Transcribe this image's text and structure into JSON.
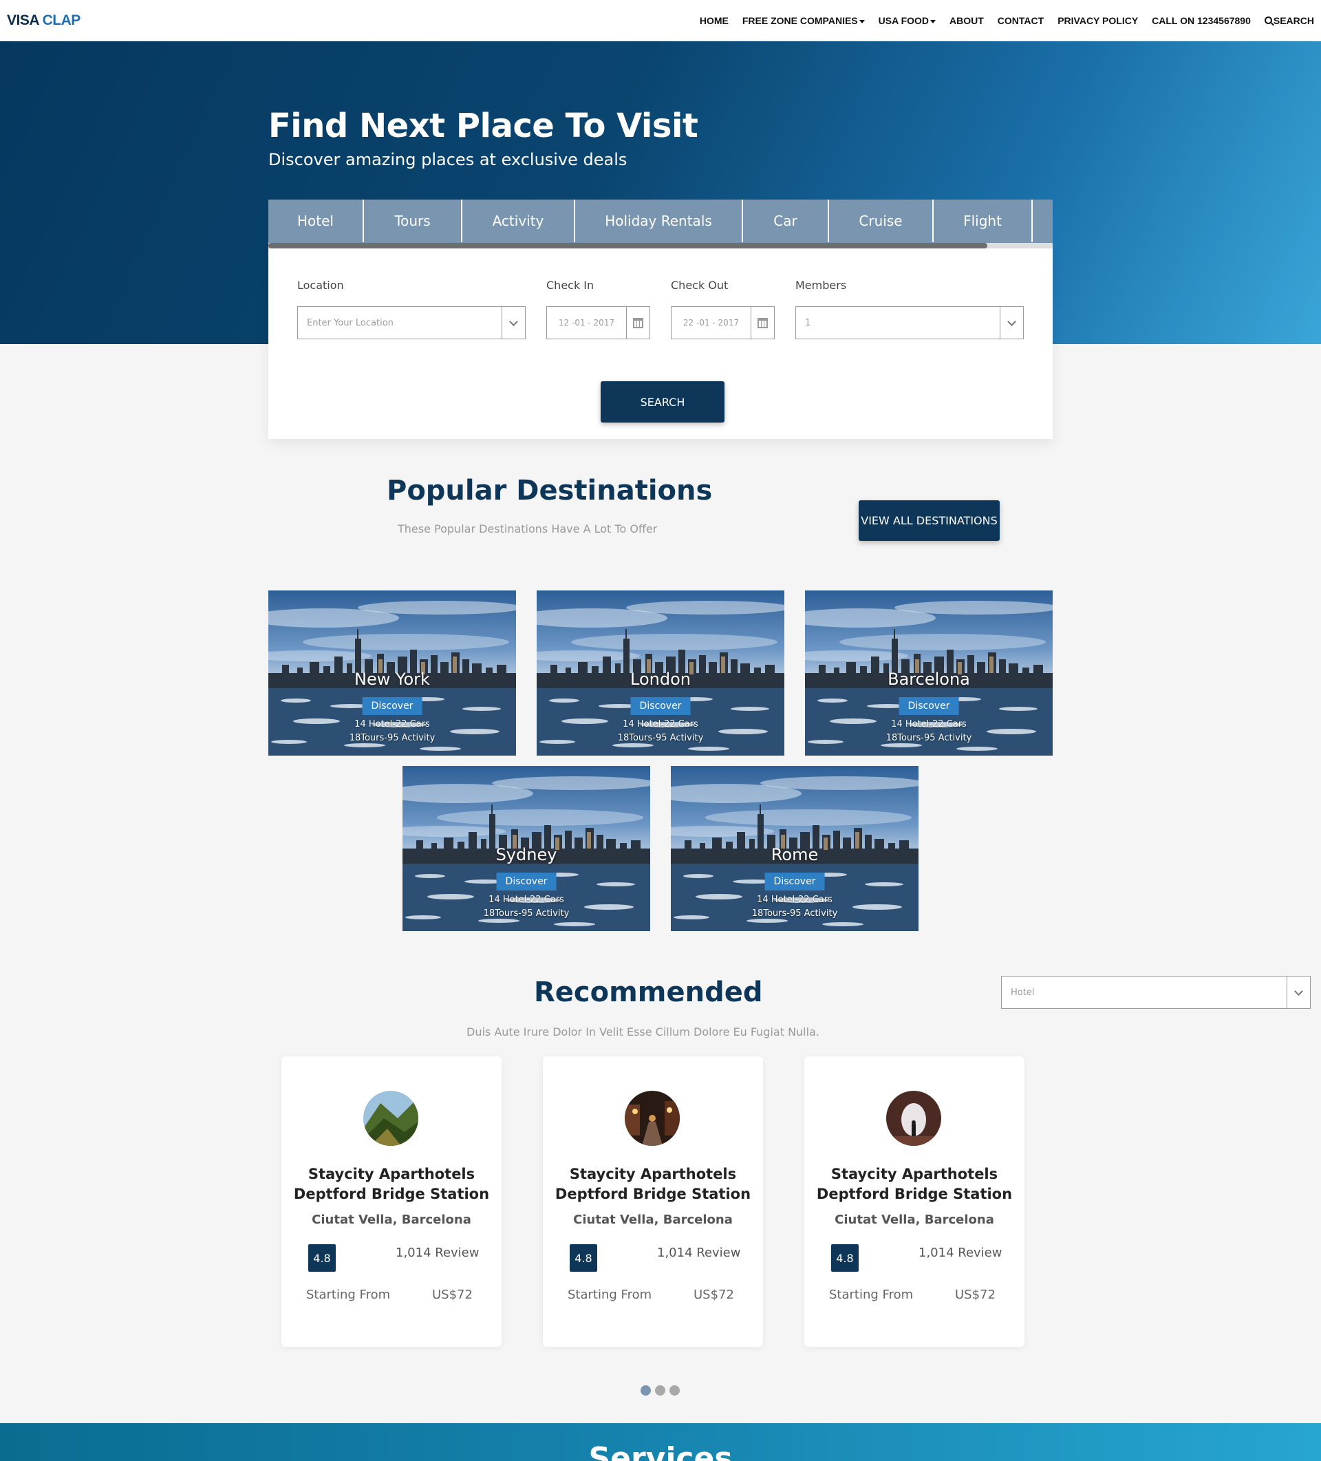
{
  "brand": {
    "part1": "VISA",
    "part2": "CLAP"
  },
  "nav": {
    "home": "HOME",
    "free_zone": "FREE ZONE COMPANIES",
    "usa_food": "USA FOOD",
    "about": "ABOUT",
    "contact": "CONTACT",
    "privacy": "PRIVACY POLICY",
    "call": "CALL ON 1234567890",
    "search": "SEARCH"
  },
  "hero": {
    "title": "Find Next Place To Visit",
    "subtitle": "Discover amazing places at exclusive deals"
  },
  "search_panel": {
    "tabs": [
      "Hotel",
      "Tours",
      "Activity",
      "Holiday Rentals",
      "Car",
      "Cruise",
      "Flight"
    ],
    "location_label": "Location",
    "location_placeholder": "Enter Your Location",
    "checkin_label": "Check In",
    "checkin_value": "12 -01 - 2017",
    "checkout_label": "Check Out",
    "checkout_value": "22 -01 - 2017",
    "members_label": "Members",
    "members_value": "1",
    "search_button": "SEARCH"
  },
  "popular": {
    "title": "Popular Destinations",
    "subtitle": "These Popular Destinations Have A Lot To Offer",
    "view_all": "VIEW ALL DESTINATIONS",
    "destinations": [
      {
        "name": "New York",
        "discover": "Discover",
        "line1": "14 Hotel-22 Cars",
        "line2": "18Tours-95 Activity"
      },
      {
        "name": "London",
        "discover": "Discover",
        "line1": "14 Hotel-22 Cars",
        "line2": "18Tours-95 Activity"
      },
      {
        "name": "Barcelona",
        "discover": "Discover",
        "line1": "14 Hotel-22 Cars",
        "line2": "18Tours-95 Activity"
      },
      {
        "name": "Sydney",
        "discover": "Discover",
        "line1": "14 Hotel-22 Cars",
        "line2": "18Tours-95 Activity"
      },
      {
        "name": "Rome",
        "discover": "Discover",
        "line1": "14 Hotel-22 Cars",
        "line2": "18Tours-95 Activity"
      }
    ]
  },
  "recommended": {
    "title": "Recommended",
    "subtitle": "Duis Aute Irure Dolor In Velit Esse Cillum Dolore Eu Fugiat Nulla.",
    "filter_value": "Hotel",
    "hotels": [
      {
        "name_line1": "Staycity Aparthotels",
        "name_line2": "Deptford Bridge Station",
        "location": "Ciutat Vella, Barcelona",
        "rating": "4.8",
        "reviews": "1,014 Review",
        "starting_from": "Starting From",
        "price": "US$72"
      },
      {
        "name_line1": "Staycity Aparthotels",
        "name_line2": "Deptford Bridge Station",
        "location": "Ciutat Vella, Barcelona",
        "rating": "4.8",
        "reviews": "1,014 Review",
        "starting_from": "Starting From",
        "price": "US$72"
      },
      {
        "name_line1": "Staycity Aparthotels",
        "name_line2": "Deptford Bridge Station",
        "location": "Ciutat Vella, Barcelona",
        "rating": "4.8",
        "reviews": "1,014 Review",
        "starting_from": "Starting From",
        "price": "US$72"
      }
    ],
    "carousel_page": 1,
    "carousel_pages": 3
  },
  "services": {
    "title": "Services"
  },
  "colors": {
    "primary": "#0d3658",
    "accent": "#2f7fc4",
    "tab_bg": "#7995b0"
  }
}
